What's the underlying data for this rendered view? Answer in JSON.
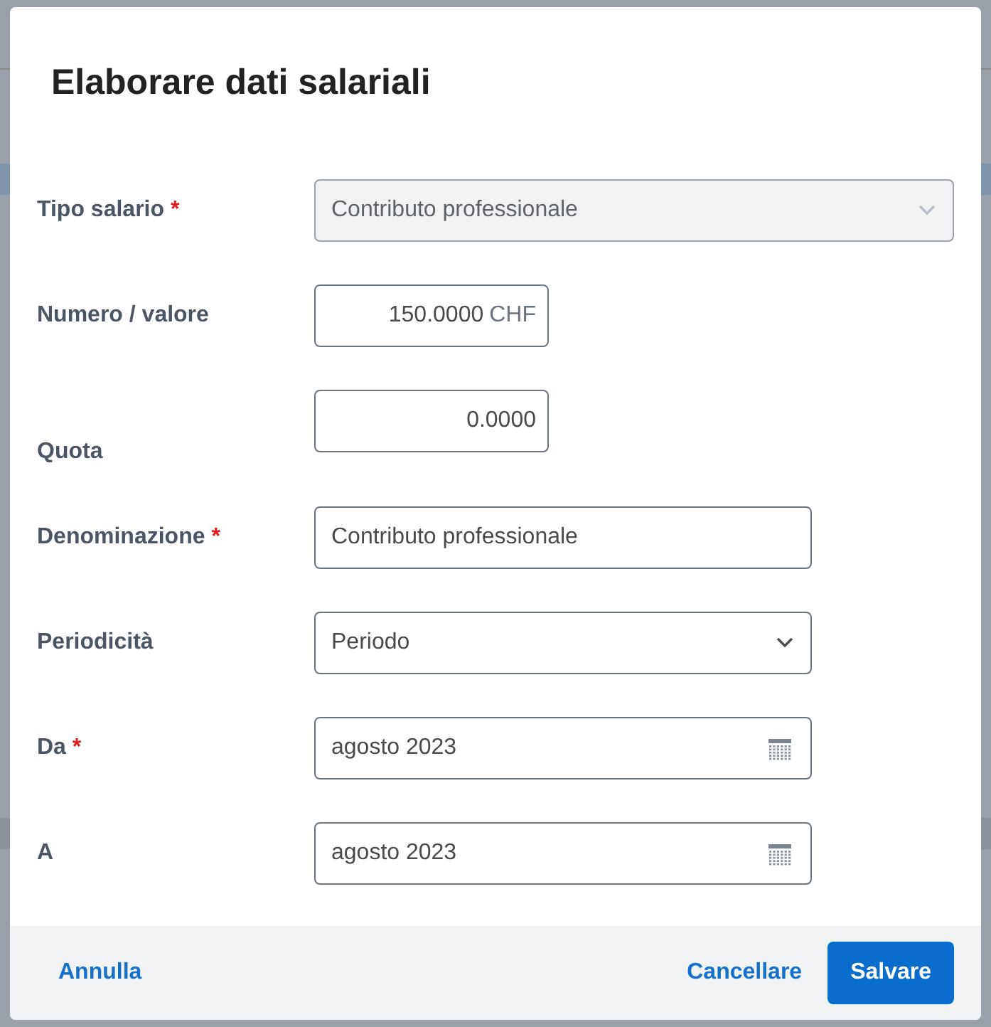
{
  "dialog": {
    "title": "Elaborare dati salariali"
  },
  "fields": [
    {
      "kind": "select",
      "label": "Tipo salario",
      "required_mark": "*",
      "value": "Contributo professionale",
      "disabled": true
    },
    {
      "kind": "number",
      "label": "Numero / valore",
      "value": "150.0000",
      "unit": "CHF"
    },
    {
      "kind": "number",
      "label": "Quota",
      "value": "0.0000"
    },
    {
      "kind": "text",
      "label": "Denominazione",
      "required_mark": "*",
      "value": "Contributo professionale"
    },
    {
      "kind": "select",
      "label": "Periodicità",
      "value": "Periodo",
      "disabled": false
    },
    {
      "kind": "date",
      "label": "Da",
      "required_mark": "*",
      "value": "agosto 2023"
    },
    {
      "kind": "date",
      "label": "A",
      "value": "agosto 2023"
    }
  ],
  "footer": {
    "buttons": [
      {
        "kind": "link",
        "label": "Annulla"
      },
      {
        "kind": "link",
        "label": "Cancellare"
      },
      {
        "kind": "primary",
        "label": "Salvare"
      }
    ]
  }
}
